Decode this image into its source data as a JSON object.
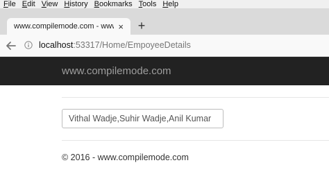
{
  "menubar": {
    "items": [
      {
        "key": "F",
        "rest": "ile"
      },
      {
        "key": "E",
        "rest": "dit"
      },
      {
        "key": "V",
        "rest": "iew"
      },
      {
        "key": "H",
        "rest": "istory"
      },
      {
        "key": "B",
        "rest": "ookmarks"
      },
      {
        "key": "T",
        "rest": "ools"
      },
      {
        "key": "H",
        "rest": "elp"
      }
    ]
  },
  "browser": {
    "tab_title": "www.compilemode.com - www...",
    "tab_close": "×",
    "new_tab": "+",
    "url_host": "localhost",
    "url_path": ":53317/Home/EmpoyeeDetails"
  },
  "site": {
    "brand": "www.compilemode.com",
    "names_value": "Vithal Wadje,Suhir Wadje,Anil Kumar",
    "footer": "© 2016 - www.compilemode.com"
  }
}
